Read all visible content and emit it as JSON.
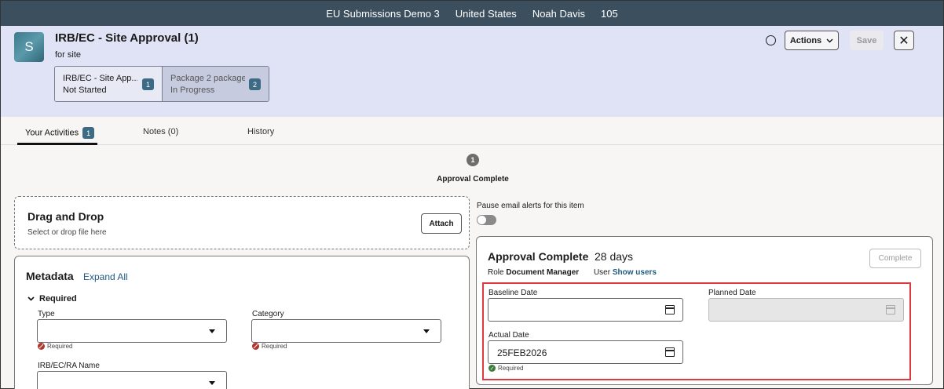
{
  "topbar": {
    "study": "EU Submissions Demo 3",
    "country": "United States",
    "user": "Noah Davis",
    "count": "105"
  },
  "header": {
    "avatar_letter": "S",
    "title": "IRB/EC - Site Approval (1)",
    "subtitle": "for site",
    "actions_label": "Actions",
    "save_label": "Save",
    "close_glyph": "✕"
  },
  "steps": [
    {
      "name": "IRB/EC - Site Approval",
      "display_name": "IRB/EC - Site App...",
      "status": "Not Started",
      "badge": "1"
    },
    {
      "name": "Package 2 package",
      "display_name": "Package 2 package...",
      "status": "In Progress",
      "badge": "2"
    }
  ],
  "tabs": {
    "activities": "Your Activities",
    "activities_count": "1",
    "notes": "Notes (0)",
    "history": "History"
  },
  "stage": {
    "number": "1",
    "label": "Approval Complete"
  },
  "dragdrop": {
    "title": "Drag and Drop",
    "subtitle": "Select or drop file here",
    "attach_label": "Attach"
  },
  "metadata": {
    "title": "Metadata",
    "expand_label": "Expand All",
    "section_label": "Required",
    "type_label": "Type",
    "category_label": "Category",
    "name_label": "IRB/EC/RA Name",
    "required_note": "Required"
  },
  "alerts": {
    "pause_label": "Pause email alerts for this item",
    "pause_on": false
  },
  "approval": {
    "title": "Approval Complete",
    "duration": "28 days",
    "complete_label": "Complete",
    "role_label": "Role",
    "role_value": "Document Manager",
    "user_label": "User",
    "show_users": "Show users",
    "baseline_label": "Baseline Date",
    "baseline_value": "",
    "planned_label": "Planned Date",
    "planned_value": "",
    "actual_label": "Actual Date",
    "actual_value": "25FEB2026",
    "actual_note": "Required"
  },
  "colors": {
    "topbar": "#3c4f5e",
    "header": "#dfe3f5",
    "badge": "#3d6b86",
    "link": "#1f5a80",
    "highlight": "#e0383e",
    "error": "#b0352a",
    "success": "#3a7d3a"
  }
}
